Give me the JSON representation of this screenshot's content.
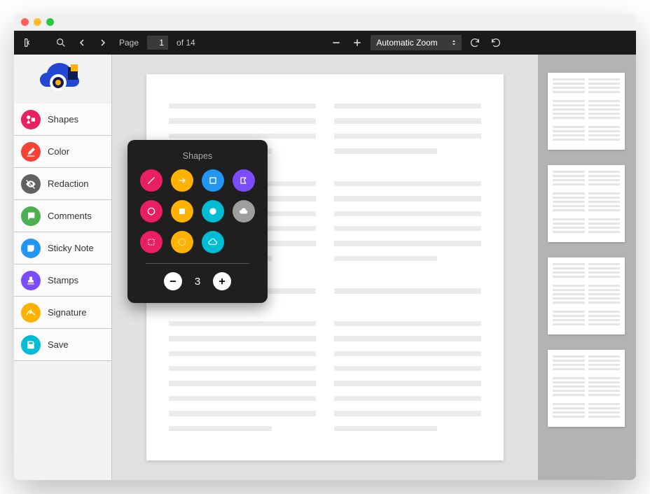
{
  "toolbar": {
    "page_label": "Page",
    "page_current": "1",
    "page_total_label": "of 14",
    "zoom_label": "Automatic Zoom"
  },
  "sidebar": {
    "items": [
      {
        "label": "Shapes",
        "color": "#e91e63"
      },
      {
        "label": "Color",
        "color": "#f44336"
      },
      {
        "label": "Redaction",
        "color": "#616161"
      },
      {
        "label": "Comments",
        "color": "#4caf50"
      },
      {
        "label": "Sticky Note",
        "color": "#2196f3"
      },
      {
        "label": "Stamps",
        "color": "#7c4dff"
      },
      {
        "label": "Signature",
        "color": "#ffb300"
      },
      {
        "label": "Save",
        "color": "#00bcd4"
      }
    ]
  },
  "shapes_popup": {
    "title": "Shapes",
    "stroke_value": "3",
    "shapes": [
      {
        "name": "line",
        "color": "#e91e63"
      },
      {
        "name": "arrow",
        "color": "#ffb300"
      },
      {
        "name": "rectangle",
        "color": "#2196f3"
      },
      {
        "name": "polygon",
        "color": "#7c4dff"
      },
      {
        "name": "circle",
        "color": "#e91e63"
      },
      {
        "name": "filled-rect",
        "color": "#ffb300"
      },
      {
        "name": "filled-circle",
        "color": "#00bcd4"
      },
      {
        "name": "cloud-filled",
        "color": "#9e9e9e"
      },
      {
        "name": "dotted-rect",
        "color": "#e91e63"
      },
      {
        "name": "dotted-circle",
        "color": "#ffb300"
      },
      {
        "name": "cloud-outline",
        "color": "#00bcd4"
      }
    ]
  }
}
